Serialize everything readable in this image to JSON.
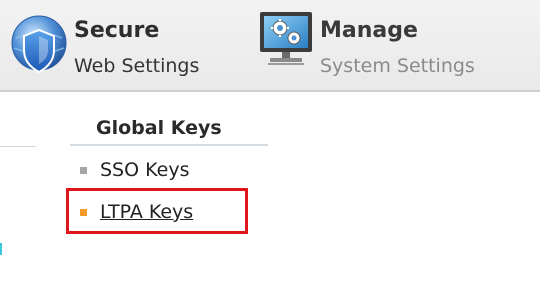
{
  "nav": {
    "secure": {
      "title": "Secure",
      "subtitle": "Web Settings",
      "icon": "shield-globe-icon"
    },
    "manage": {
      "title": "Manage",
      "subtitle": "System Settings",
      "icon": "monitor-gears-icon"
    }
  },
  "submenu": {
    "heading": "Global Keys",
    "items": [
      {
        "label": "SSO Keys",
        "state": "inactive"
      },
      {
        "label": "LTPA Keys",
        "state": "active"
      }
    ]
  },
  "colors": {
    "highlight_border": "#e0141b",
    "active_bullet": "#f29b2b",
    "inactive_bullet": "#a6a6a6"
  }
}
